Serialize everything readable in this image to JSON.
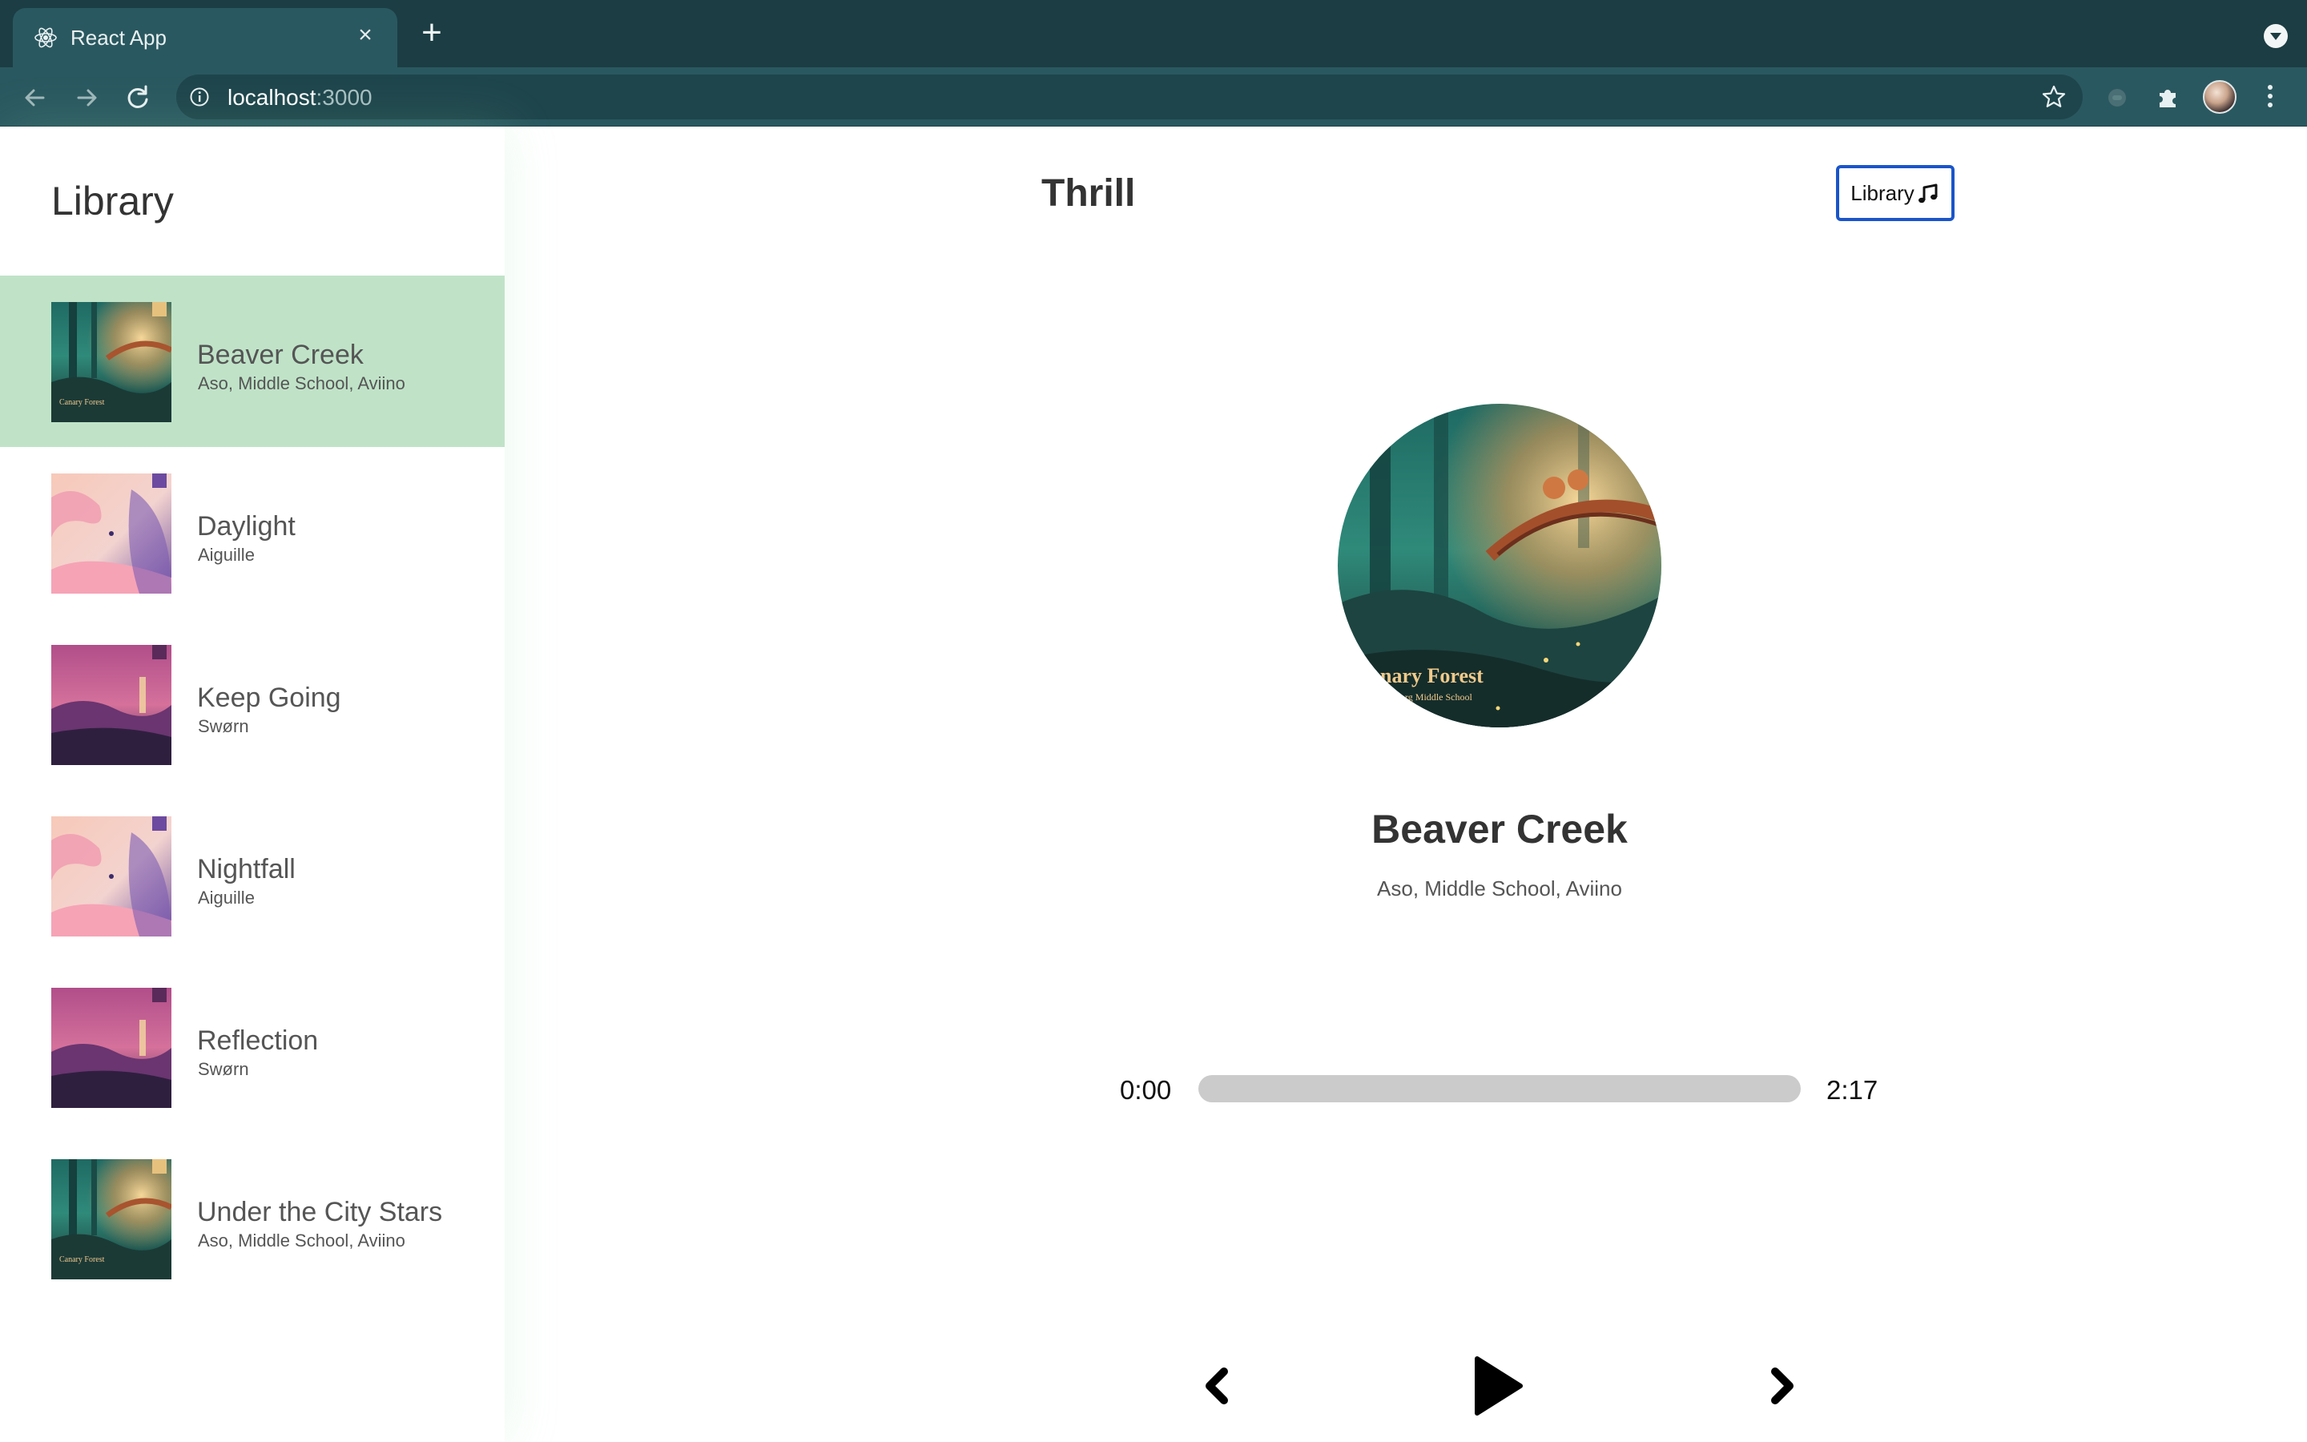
{
  "browser": {
    "tab_title": "React App",
    "tab_close": "×",
    "new_tab": "+",
    "url_host": "localhost",
    "url_port": ":3000",
    "icons": [
      "react-favicon-icon",
      "back-arrow-icon",
      "forward-arrow-icon",
      "reload-icon",
      "info-icon",
      "star-icon",
      "extension-icon",
      "puzzle-icon",
      "avatar",
      "kebab-menu-icon",
      "profile-menu-icon"
    ]
  },
  "library": {
    "title": "Library",
    "songs": [
      {
        "name": "Beaver Creek",
        "artist": "Aso, Middle School, Aviino",
        "selected": true,
        "cover": "canary-forest"
      },
      {
        "name": "Daylight",
        "artist": "Aiguille",
        "selected": false,
        "cover": "pink-clouds"
      },
      {
        "name": "Keep Going",
        "artist": "Swørn",
        "selected": false,
        "cover": "pink-lake"
      },
      {
        "name": "Nightfall",
        "artist": "Aiguille",
        "selected": false,
        "cover": "pink-clouds"
      },
      {
        "name": "Reflection",
        "artist": "Swørn",
        "selected": false,
        "cover": "pink-lake"
      },
      {
        "name": "Under the City Stars",
        "artist": "Aso, Middle School, Aviino",
        "selected": false,
        "cover": "canary-forest"
      }
    ],
    "selected_color": "#c0e3c8"
  },
  "player": {
    "brand": "Thrill",
    "library_button_label": "Library",
    "library_button_icon": "music-note-icon",
    "current_track": {
      "title": "Beaver Creek",
      "artist": "Aso, Middle School, Aviino",
      "cover_text": "anary Forest",
      "cover_subtext": "Boorg Middle School"
    },
    "time_current": "0:00",
    "time_total": "2:17",
    "progress": 0,
    "accent_color": "#1a55c9",
    "controls": [
      "chevron-left-icon",
      "play-icon",
      "chevron-right-icon"
    ]
  }
}
